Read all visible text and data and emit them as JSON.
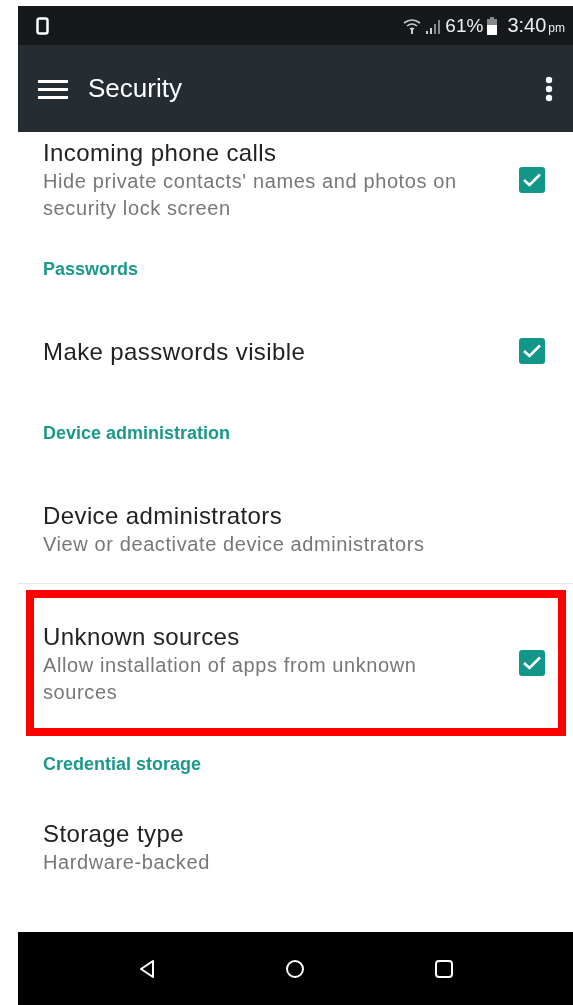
{
  "status_bar": {
    "battery": "61%",
    "time": "3:40",
    "ampm": "pm"
  },
  "toolbar": {
    "title": "Security"
  },
  "list": [
    {
      "kind": "item",
      "title": "Incoming phone calls",
      "summary": "Hide private contacts' names and photos on security lock screen",
      "checkbox": true,
      "checked": true,
      "highlighted": false,
      "divider": false
    },
    {
      "kind": "header",
      "title": "Passwords"
    },
    {
      "kind": "item",
      "title": "Make passwords visible",
      "checkbox": true,
      "checked": true,
      "highlighted": false,
      "divider": false
    },
    {
      "kind": "header",
      "title": "Device administration"
    },
    {
      "kind": "item",
      "title": "Device administrators",
      "summary": "View or deactivate device administrators",
      "checkbox": false,
      "highlighted": false,
      "divider": true
    },
    {
      "kind": "item",
      "title": "Unknown sources",
      "summary": "Allow installation of apps from unknown sources",
      "checkbox": true,
      "checked": true,
      "highlighted": true,
      "divider": false
    },
    {
      "kind": "header",
      "title": "Credential storage"
    },
    {
      "kind": "item",
      "title": "Storage type",
      "summary": "Hardware-backed",
      "checkbox": false,
      "highlighted": false,
      "divider": false
    }
  ]
}
